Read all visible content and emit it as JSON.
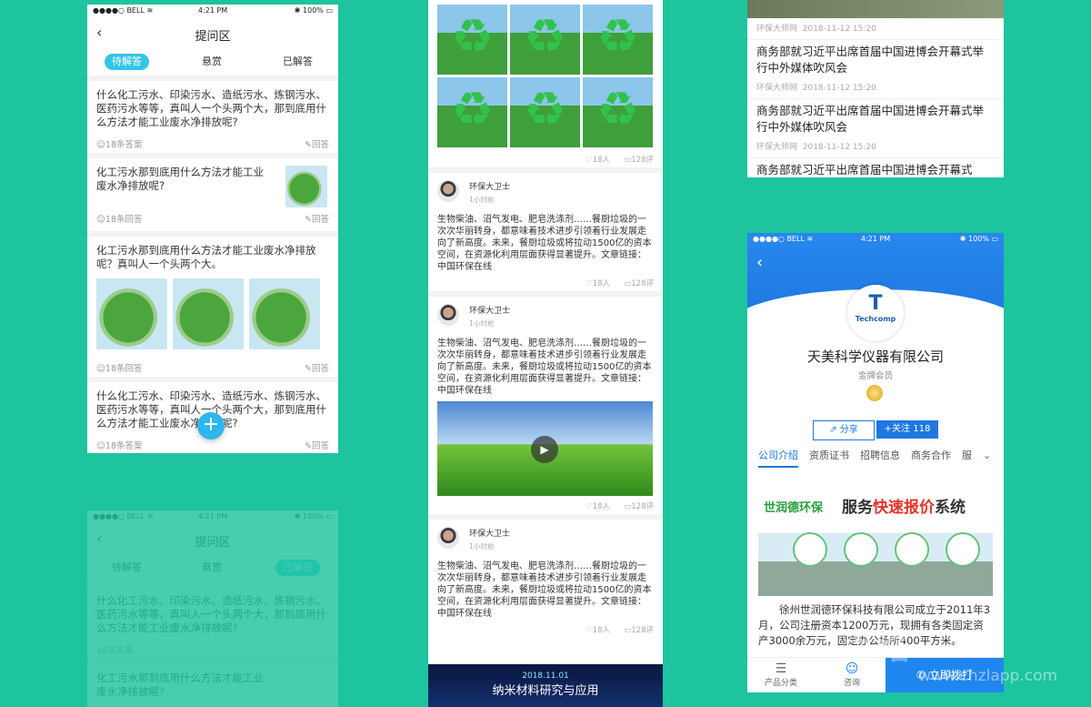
{
  "status": {
    "carrier": "●●●●○ BELL ≋",
    "time": "4:21 PM",
    "battery": "✱ 100% ▭"
  },
  "qa": {
    "title": "提问区",
    "tabs": [
      "待解答",
      "悬赏",
      "已解答"
    ],
    "questions": [
      {
        "text": "什么化工污水、印染污水、造纸污水、炼钢污水、医药污水等等，真叫人一个头两个大，那到底用什么方法才能工业废水净排放呢?",
        "count": "18条答案",
        "action": "回答"
      },
      {
        "text": "化工污水那到底用什么方法才能工业废水净排放呢?",
        "count": "18条回答",
        "action": "回答"
      },
      {
        "text": "化工污水那到底用什么方法才能工业废水净排放呢？真叫人一个头两个大。",
        "count": "18条回答",
        "action": "回答"
      },
      {
        "text": "什么化工污水、印染污水、造纸污水、炼钢污水、医药污水等等，真叫人一个头两个大，那到底用什么方法才能工业废水净排放呢?",
        "count": "18条答案",
        "action": "回答"
      }
    ]
  },
  "feed": {
    "stats": {
      "people": "18人",
      "comments": "128评"
    },
    "author": "环保大卫士",
    "time": "1小时前",
    "body": "生物柴油、沼气发电、肥皂洗涤剂……餐厨垃圾的一次次华丽转身，都意味着技术进步引领着行业发展走向了新高度。未来，餐厨垃圾或将拉动1500亿的资本空间，在资源化利用层面获得显著提升。文章链接：中国环保在线",
    "banner_date": "2018.11.01",
    "banner_title": "纳米材料研究与应用"
  },
  "news": {
    "source": "环保大师网",
    "time": "2018-11-12 15:20",
    "headline": "商务部就习近平出席首届中国进博会开幕式举行中外媒体吹风会",
    "headline_partial": "商务部就习近平出席首届中国进博会开幕式"
  },
  "company": {
    "logo_text": "Techcomp",
    "name": "天美科学仪器有限公司",
    "level": "金牌会员",
    "share": "分享",
    "follow": "+关注 118",
    "tabs": [
      "公司介绍",
      "资质证书",
      "招聘信息",
      "商务合作",
      "服"
    ],
    "ad_brand": "世润德环保",
    "ad_slogan_a": "服务",
    "ad_slogan_b": "快速报价",
    "ad_slogan_c": "系统",
    "desc": "徐州世润德环保科技有限公司成立于2011年3月，公司注册资本1200万元，现拥有各类固定资产3000余万元，固定办公场所400平方米。",
    "nav_category": "产品分类",
    "nav_consult": "咨询",
    "call": "立即拨打"
  },
  "watermark": "www.chzlapp.com",
  "watermark_big": "点略"
}
